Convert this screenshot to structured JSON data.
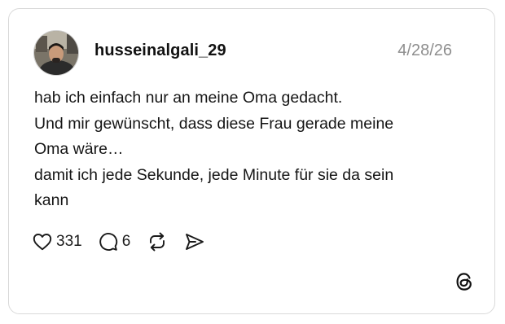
{
  "post": {
    "username": "husseinalgali_29",
    "date": "4/28/26",
    "lines": [
      "hab ich einfach nur an meine Oma gedacht.",
      "Und mir gewünscht, dass diese Frau gerade meine",
      "Oma wäre…",
      "damit ich jede Sekunde, jede Minute für sie da sein",
      "kann"
    ]
  },
  "actions": {
    "likes": "331",
    "replies": "6",
    "like_icon": "heart-icon",
    "reply_icon": "speech-bubble-icon",
    "repost_icon": "repost-arrows-icon",
    "share_icon": "send-arrow-icon"
  },
  "brand": {
    "logo_icon": "threads-logo-icon"
  }
}
